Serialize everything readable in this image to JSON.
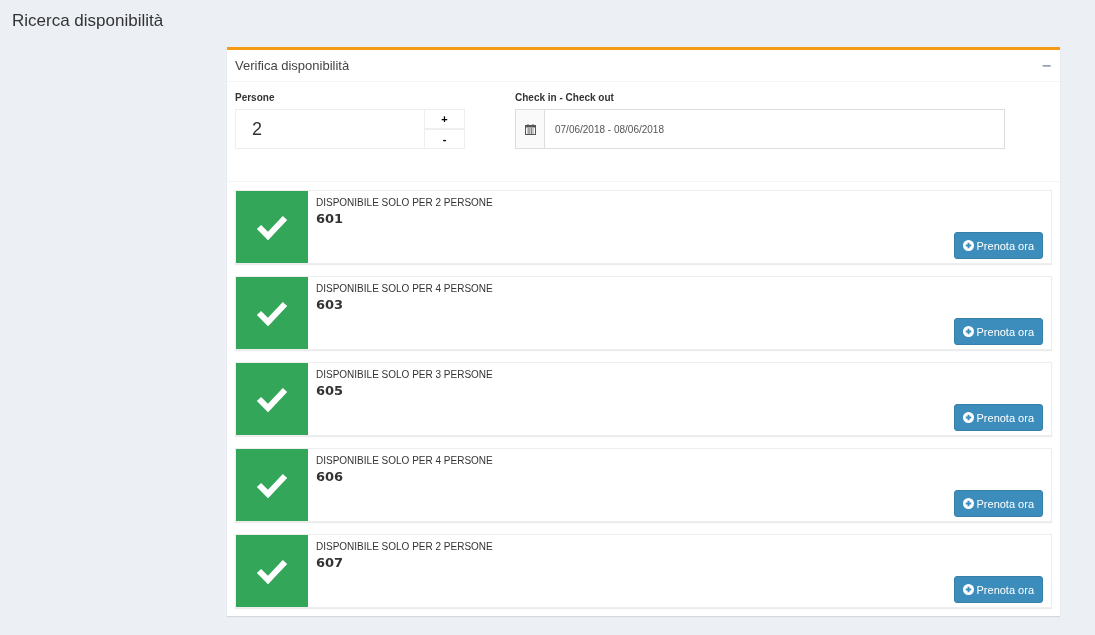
{
  "page_title": "Ricerca disponibilità",
  "panel": {
    "title": "Verifica disponibilità",
    "collapse_icon": "−"
  },
  "persons": {
    "label": "Persone",
    "value": "2",
    "increment": "+",
    "decrement": "-"
  },
  "dates": {
    "label": "Check in - Check out",
    "value": "07/06/2018 - 08/06/2018"
  },
  "rooms": [
    {
      "availability": "DISPONIBILE SOLO PER 2 PERSONE",
      "number": "601",
      "button": "Prenota ora"
    },
    {
      "availability": "DISPONIBILE SOLO PER 4 PERSONE",
      "number": "603",
      "button": "Prenota ora"
    },
    {
      "availability": "DISPONIBILE SOLO PER 3 PERSONE",
      "number": "605",
      "button": "Prenota ora"
    },
    {
      "availability": "DISPONIBILE SOLO PER 4 PERSONE",
      "number": "606",
      "button": "Prenota ora"
    },
    {
      "availability": "DISPONIBILE SOLO PER 2 PERSONE",
      "number": "607",
      "button": "Prenota ora"
    }
  ]
}
